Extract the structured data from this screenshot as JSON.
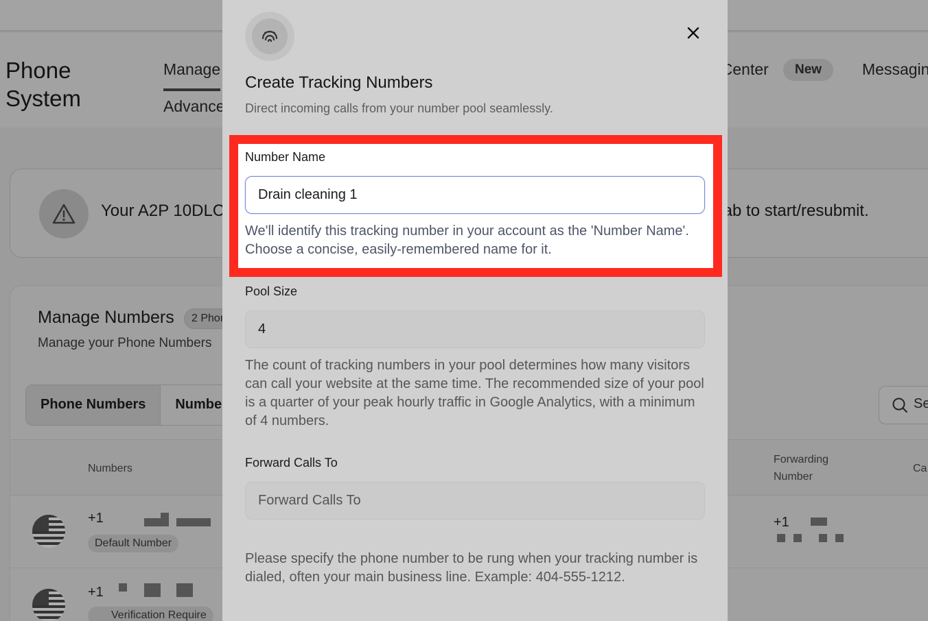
{
  "page": {
    "app_title_line1": "Phone",
    "app_title_line2": "System",
    "nav": {
      "tab_manage": "Manage",
      "tab_advanced": "Advance",
      "tab_center": "t Center",
      "badge_new": "New",
      "tab_messaging": "Messagin"
    },
    "alert": {
      "text_left": "Your A2P 10DLC",
      "text_right": "tab to start/resubmit."
    },
    "manage": {
      "title": "Manage Numbers",
      "count_badge": "2 Phon",
      "subtitle": "Manage your Phone Numbers",
      "segments": [
        "Phone Numbers",
        "Number"
      ],
      "search_placeholder": "Se",
      "table_headers": {
        "numbers": "Numbers",
        "forwarding_line1": "Forwarding",
        "forwarding_line2": "Number",
        "calls": "Ca"
      },
      "rows": [
        {
          "number_prefix": "+1",
          "tag": "Default Number",
          "forward_prefix": "+1"
        },
        {
          "number_prefix": "+1",
          "tag": "Verification Require"
        }
      ]
    }
  },
  "modal": {
    "title": "Create Tracking Numbers",
    "subtitle": "Direct incoming calls from your number pool seamlessly.",
    "icon": "fingerprint-icon",
    "close_icon": "close-icon",
    "fields": {
      "number_name": {
        "label": "Number Name",
        "value": "Drain cleaning 1",
        "help": "We'll identify this tracking number in your account as the 'Number Name'. Choose a concise, easily-remembered name for it."
      },
      "pool_size": {
        "label": "Pool Size",
        "value": "4",
        "help": "The count of tracking numbers in your pool determines how many visitors can call your website at the same time. The recommended size of your pool is a quarter of your peak hourly traffic in Google Analytics, with a minimum of 4 numbers."
      },
      "forward_calls": {
        "label": "Forward Calls To",
        "placeholder": "Forward Calls To",
        "help": "Please specify the phone number to be rung when your tracking number is dialed, often your main business line. Example: 404-555-1212."
      }
    }
  },
  "colors": {
    "highlight": "#ff2a1f",
    "focus_border": "#7a8cd6",
    "overlay_bg": "#9c9c9c"
  }
}
